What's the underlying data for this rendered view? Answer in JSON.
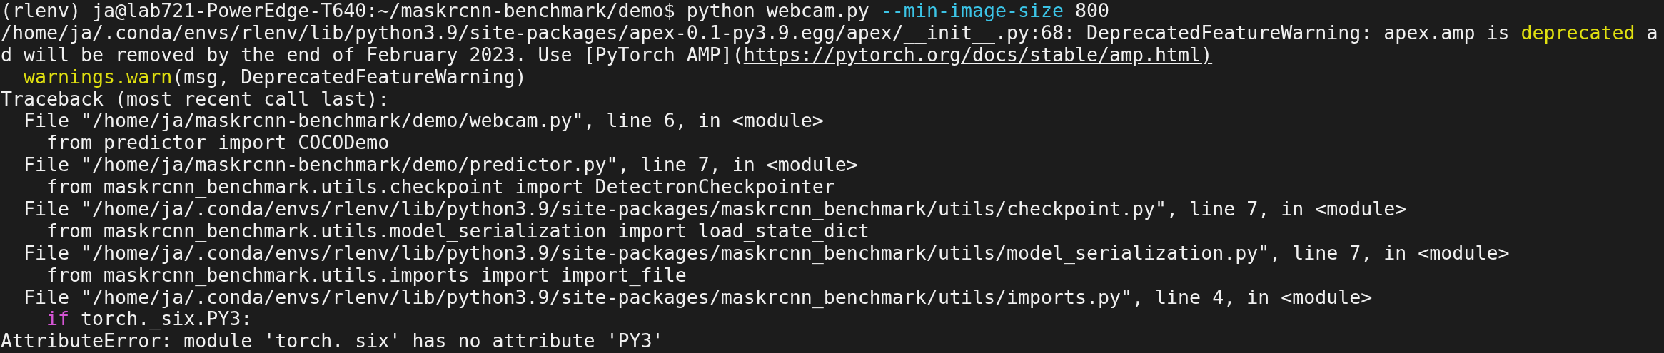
{
  "terminal": {
    "lines": [
      {
        "segments": [
          {
            "kind": "plain",
            "text": "(rlenv) ja@lab721-PowerEdge-T640:~/maskrcnn-benchmark/demo$ python webcam.py "
          },
          {
            "kind": "option",
            "text": "--min-image-size"
          },
          {
            "kind": "plain",
            "text": " 800"
          }
        ]
      },
      {
        "segments": [
          {
            "kind": "plain",
            "text": "/home/ja/.conda/envs/rlenv/lib/python3.9/site-packages/apex-0.1-py3.9.egg/apex/__init__.py:68: DeprecatedFeatureWarning: apex.amp is "
          },
          {
            "kind": "warn",
            "text": "deprecated"
          },
          {
            "kind": "plain",
            "text": " a"
          }
        ]
      },
      {
        "segments": [
          {
            "kind": "plain",
            "text": "d will be removed by the end of February 2023. Use [PyTorch AMP]("
          },
          {
            "kind": "link",
            "text": "https://pytorch.org/docs/stable/amp.html)"
          }
        ]
      },
      {
        "segments": [
          {
            "kind": "warn",
            "text": "  warnings.warn"
          },
          {
            "kind": "plain",
            "text": "(msg, DeprecatedFeatureWarning)"
          }
        ]
      },
      {
        "segments": [
          {
            "kind": "plain",
            "text": "Traceback (most recent call last):"
          }
        ]
      },
      {
        "segments": [
          {
            "kind": "plain",
            "text": "  File \"/home/ja/maskrcnn-benchmark/demo/webcam.py\", line 6, in <module>"
          }
        ]
      },
      {
        "segments": [
          {
            "kind": "plain",
            "text": "    from predictor import COCODemo"
          }
        ]
      },
      {
        "segments": [
          {
            "kind": "plain",
            "text": "  File \"/home/ja/maskrcnn-benchmark/demo/predictor.py\", line 7, in <module>"
          }
        ]
      },
      {
        "segments": [
          {
            "kind": "plain",
            "text": "    from maskrcnn_benchmark.utils.checkpoint import DetectronCheckpointer"
          }
        ]
      },
      {
        "segments": [
          {
            "kind": "plain",
            "text": "  File \"/home/ja/.conda/envs/rlenv/lib/python3.9/site-packages/maskrcnn_benchmark/utils/checkpoint.py\", line 7, in <module>"
          }
        ]
      },
      {
        "segments": [
          {
            "kind": "plain",
            "text": "    from maskrcnn_benchmark.utils.model_serialization import load_state_dict"
          }
        ]
      },
      {
        "segments": [
          {
            "kind": "plain",
            "text": "  File \"/home/ja/.conda/envs/rlenv/lib/python3.9/site-packages/maskrcnn_benchmark/utils/model_serialization.py\", line 7, in <module>"
          }
        ]
      },
      {
        "segments": [
          {
            "kind": "plain",
            "text": "    from maskrcnn_benchmark.utils.imports import import_file"
          }
        ]
      },
      {
        "segments": [
          {
            "kind": "plain",
            "text": "  File \"/home/ja/.conda/envs/rlenv/lib/python3.9/site-packages/maskrcnn_benchmark/utils/imports.py\", line 4, in <module>"
          }
        ]
      },
      {
        "segments": [
          {
            "kind": "keyword",
            "text": "    if"
          },
          {
            "kind": "plain",
            "text": " torch._six.PY3:"
          }
        ]
      },
      {
        "segments": [
          {
            "kind": "plain",
            "text": "AttributeError: module 'torch. six' has no attribute 'PY3'"
          }
        ]
      }
    ]
  }
}
